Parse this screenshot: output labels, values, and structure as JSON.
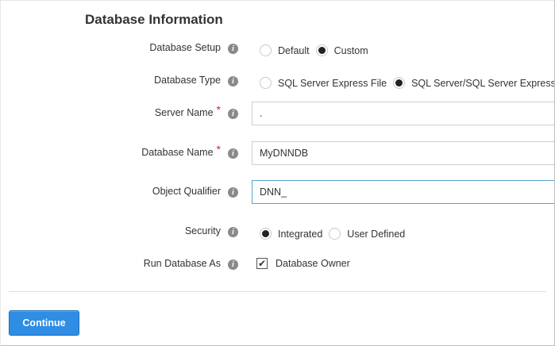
{
  "section_title": "Database Information",
  "fields": {
    "setup": {
      "label": "Database Setup",
      "options": [
        "Default",
        "Custom"
      ],
      "selected": "Custom"
    },
    "type": {
      "label": "Database Type",
      "options": [
        "SQL Server Express File",
        "SQL Server/SQL Server Express"
      ],
      "selected": "SQL Server/SQL Server Express"
    },
    "server_name": {
      "label": "Server Name",
      "required_mark": "*",
      "value": "."
    },
    "database_name": {
      "label": "Database Name",
      "required_mark": "*",
      "value": "MyDNNDB"
    },
    "object_qualifier": {
      "label": "Object Qualifier",
      "value": "DNN_"
    },
    "security": {
      "label": "Security",
      "options": [
        "Integrated",
        "User Defined"
      ],
      "selected": "Integrated"
    },
    "run_as": {
      "label": "Run Database As",
      "checkbox_label": "Database Owner",
      "checked": true
    }
  },
  "continue_button": "Continue",
  "icons": {
    "info": "info-icon",
    "check": "check-icon"
  }
}
